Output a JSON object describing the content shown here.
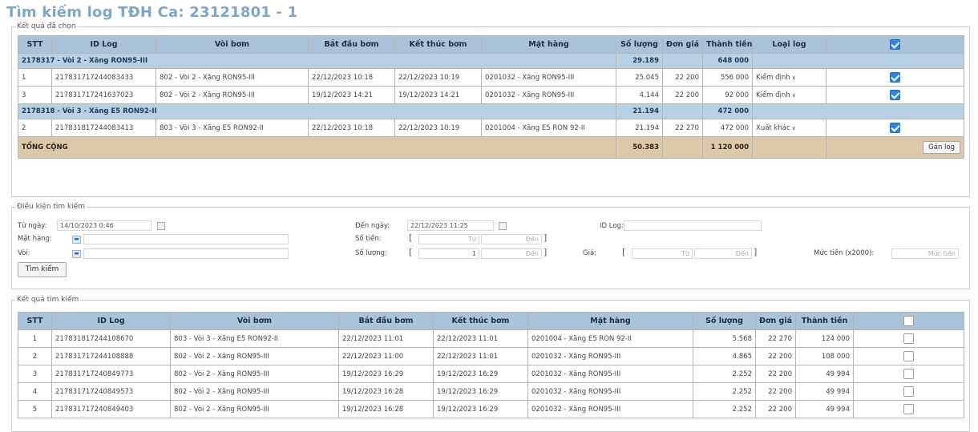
{
  "page": {
    "title": "Tìm kiếm log TĐH Ca: 23121801 - 1"
  },
  "selected": {
    "legend": "Kết quả đã chọn",
    "headers": [
      "STT",
      "ID Log",
      "Vòi bơm",
      "Bắt đầu bơm",
      "Kết thúc bơm",
      "Mặt hàng",
      "Số lượng",
      "Đơn giá",
      "Thành tiền",
      "Loại log"
    ],
    "header_checked": true,
    "groups": [
      {
        "label": "2178317 - Vòi 2 - Xăng RON95-III",
        "qty": "29.189",
        "amount": "648 000",
        "rows": [
          {
            "stt": "1",
            "id": "217831717244083433",
            "pump": "802 - Vòi 2 - Xăng RON95-III",
            "start": "22/12/2023 10:18",
            "end": "22/12/2023 10:19",
            "item": "0201032 - Xăng RON95-III",
            "qty": "25.045",
            "price": "22 200",
            "amount": "556 000",
            "type": "Kiểm định",
            "checked": true
          },
          {
            "stt": "3",
            "id": "217831717241637023",
            "pump": "802 - Vòi 2 - Xăng RON95-III",
            "start": "19/12/2023 14:21",
            "end": "19/12/2023 14:21",
            "item": "0201032 - Xăng RON95-III",
            "qty": "4.144",
            "price": "22 200",
            "amount": "92 000",
            "type": "Kiểm định",
            "checked": true
          }
        ]
      },
      {
        "label": "2178318 - Vòi 3 - Xăng E5 RON92-II",
        "qty": "21.194",
        "amount": "472 000",
        "rows": [
          {
            "stt": "2",
            "id": "217831817244083413",
            "pump": "803 - Vòi 3 - Xăng E5 RON92-II",
            "start": "22/12/2023 10:18",
            "end": "22/12/2023 10:19",
            "item": "0201004 - Xăng E5 RON 92-II",
            "qty": "21.194",
            "price": "22 270",
            "amount": "472 000",
            "type": "Xuất khác",
            "checked": true
          }
        ]
      }
    ],
    "total": {
      "label": "TỔNG CỘNG",
      "qty": "50.383",
      "amount": "1 120 000",
      "button": "Gán log"
    }
  },
  "conditions": {
    "legend": "Điều kiện tìm kiếm",
    "from_date_label": "Từ ngày:",
    "from_date": "14/10/2023 0:46",
    "item_label": "Mặt hàng:",
    "item_value": "",
    "pump_label": "Vòi:",
    "pump_value": "",
    "to_date_label": "Đến ngày:",
    "to_date": "22/12/2023 11:25",
    "money_label": "Số tiền:",
    "money_from": "Từ",
    "money_to": "Đến",
    "qty_label": "Số lượng:",
    "qty_from": "1",
    "qty_to": "Đến",
    "id_log_label": "ID Log:",
    "id_log_value": "",
    "price_label": "Giá:",
    "price_from": "Từ",
    "price_to": "Đến",
    "level_label": "Mức tiền (x2000):",
    "level_placeholder": "Mức tiền",
    "search_button": "Tìm kiếm"
  },
  "results": {
    "legend": "Kết quả tìm kiếm",
    "headers": [
      "STT",
      "ID Log",
      "Vòi bơm",
      "Bắt đầu bơm",
      "Kết thúc bơm",
      "Mặt hàng",
      "Số lượng",
      "Đơn giá",
      "Thành tiền"
    ],
    "header_checked": false,
    "rows": [
      {
        "stt": "1",
        "id": "217831817244108670",
        "pump": "803 - Vòi 3 - Xăng E5 RON92-II",
        "start": "22/12/2023 11:01",
        "end": "22/12/2023 11:01",
        "item": "0201004 - Xăng E5 RON 92-II",
        "qty": "5.568",
        "price": "22 270",
        "amount": "124 000"
      },
      {
        "stt": "2",
        "id": "217831717244108888",
        "pump": "802 - Vòi 2 - Xăng RON95-III",
        "start": "22/12/2023 11:00",
        "end": "22/12/2023 11:01",
        "item": "0201032 - Xăng RON95-III",
        "qty": "4.865",
        "price": "22 200",
        "amount": "108 000"
      },
      {
        "stt": "3",
        "id": "217831717240849773",
        "pump": "802 - Vòi 2 - Xăng RON95-III",
        "start": "19/12/2023 16:29",
        "end": "19/12/2023 16:29",
        "item": "0201032 - Xăng RON95-III",
        "qty": "2.252",
        "price": "22 200",
        "amount": "49 994"
      },
      {
        "stt": "4",
        "id": "217831717240849573",
        "pump": "802 - Vòi 2 - Xăng RON95-III",
        "start": "19/12/2023 16:28",
        "end": "19/12/2023 16:29",
        "item": "0201032 - Xăng RON95-III",
        "qty": "2.252",
        "price": "22 200",
        "amount": "49 994"
      },
      {
        "stt": "5",
        "id": "217831717240849403",
        "pump": "802 - Vòi 2 - Xăng RON95-III",
        "start": "19/12/2023 16:28",
        "end": "19/12/2023 16:29",
        "item": "0201032 - Xăng RON95-III",
        "qty": "2.252",
        "price": "22 200",
        "amount": "49 994"
      }
    ]
  }
}
